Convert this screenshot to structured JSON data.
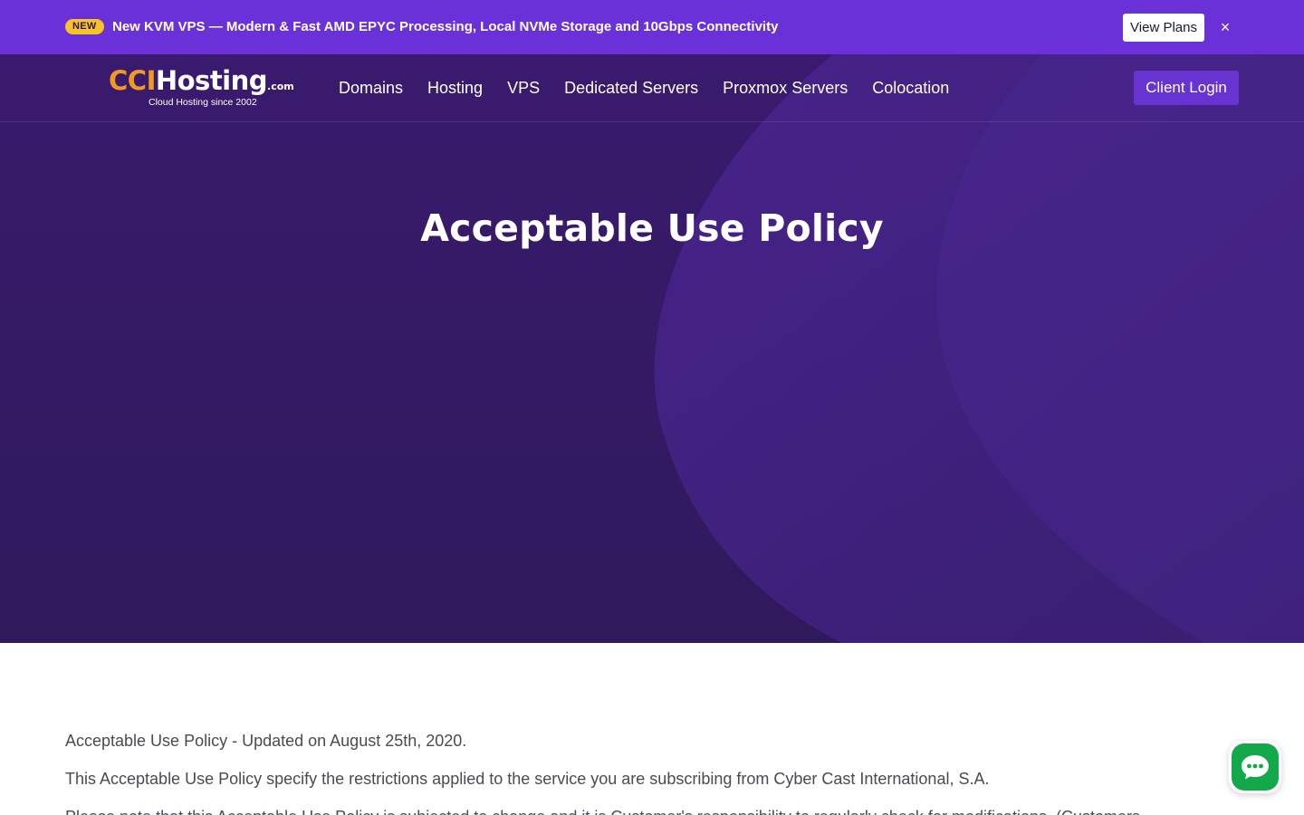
{
  "announcement": {
    "badge": "NEW",
    "text": "New KVM VPS — Modern & Fast AMD EPYC Processing, Local NVMe Storage and 10Gbps Connectivity",
    "button_label": "View Plans",
    "close_label": "×"
  },
  "logo": {
    "brand_first": "CCI",
    "brand_second": "Hosting",
    "tld": ".com",
    "tagline": "Cloud Hosting since 2002"
  },
  "nav": {
    "items": [
      {
        "label": "Domains"
      },
      {
        "label": "Hosting"
      },
      {
        "label": "VPS"
      },
      {
        "label": "Dedicated Servers"
      },
      {
        "label": "Proxmox Servers"
      },
      {
        "label": "Colocation"
      }
    ],
    "login_label": "Client Login"
  },
  "hero": {
    "title": "Acceptable Use Policy"
  },
  "content": {
    "paragraphs": [
      "Acceptable Use Policy - Updated on August 25th, 2020.",
      "This Acceptable Use Policy specify the restrictions applied to the service you are subscribing from Cyber Cast International, S.A.",
      "Please note that this Acceptable Use Policy is subjected to change and it is Customer's responsibility to regularly check for modifications. (Customers"
    ]
  },
  "colors": {
    "announcement_bg": "#6b31d8",
    "badge_bg": "#f7c325",
    "hero_bg": "#33195f",
    "brand_orange": "#f39a1e",
    "login_button_bg": "#6733d1",
    "chat_green": "#13a84a",
    "body_text": "#4a4a52"
  },
  "icons": {
    "close": "close-icon",
    "chat": "chat-bubble-icon"
  }
}
